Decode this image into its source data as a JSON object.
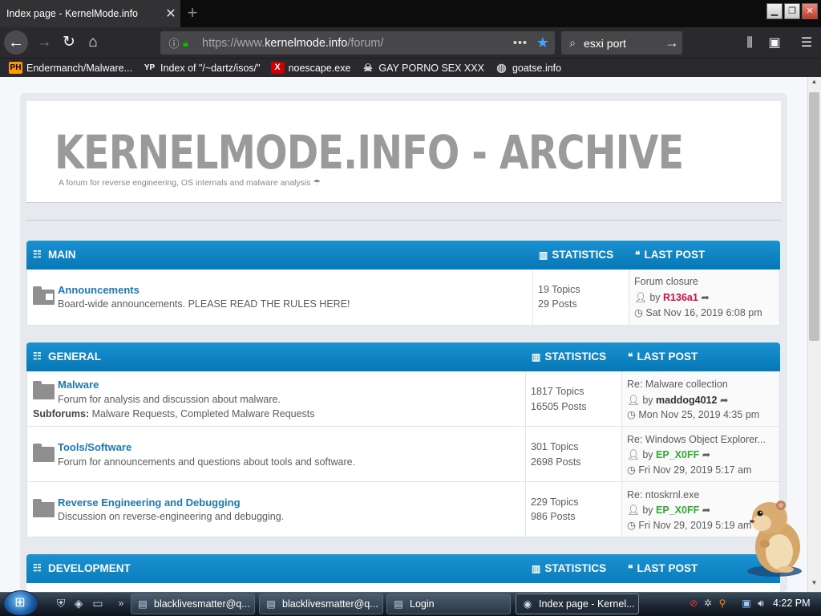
{
  "browser": {
    "tab_title": "Index page - KernelMode.info",
    "tab_close": "✕",
    "new_tab": "+",
    "url_host_pre": "https://www.",
    "url_host": "kernelmode.info",
    "url_path": "/forum/",
    "search_value": "esxi port",
    "bookmarks": [
      {
        "icon": "PH",
        "label": "Endermanch/Malware..."
      },
      {
        "icon": "YP",
        "label": "Index of \"/~dartz/isos/\""
      },
      {
        "icon": "X",
        "label": "noescape.exe"
      },
      {
        "icon": "☠",
        "label": "GAY PORNO SEX XXX"
      },
      {
        "icon": "◍",
        "label": "goatse.info"
      }
    ],
    "window_controls": [
      "▁",
      "❐",
      "✕"
    ]
  },
  "site": {
    "logo": "KERNELMODE.INFO - ARCHIVE",
    "tagline": "A forum for reverse engineering, OS internals and malware analysis ☂"
  },
  "categories": [
    {
      "title": "MAIN",
      "stats_label": "STATISTICS",
      "lastpost_label": "LAST POST",
      "forums": [
        {
          "title": "Announcements",
          "desc": "Board-wide announcements. PLEASE READ THE RULES HERE!",
          "subforums": "",
          "topics": "19 Topics",
          "posts": "29 Posts",
          "last_title": "Forum closure",
          "last_by": "by",
          "last_user": "R136a1",
          "last_user_color": "#d31141",
          "last_date": "Sat Nov 16, 2019 6:08 pm"
        }
      ]
    },
    {
      "title": "GENERAL",
      "stats_label": "STATISTICS",
      "lastpost_label": "LAST POST",
      "forums": [
        {
          "title": "Malware",
          "desc": "Forum for analysis and discussion about malware.",
          "subforums_label": "Subforums:",
          "subforums": "Malware Requests, Completed Malware Requests",
          "topics": "1817 Topics",
          "posts": "16505 Posts",
          "last_title": "Re: Malware collection",
          "last_by": "by",
          "last_user": "maddog4012",
          "last_user_color": "#333333",
          "last_date": "Mon Nov 25, 2019 4:35 pm"
        },
        {
          "title": "Tools/Software",
          "desc": "Forum for announcements and questions about tools and software.",
          "subforums": "",
          "topics": "301 Topics",
          "posts": "2698 Posts",
          "last_title": "Re: Windows Object Explorer...",
          "last_by": "by",
          "last_user": "EP_X0FF",
          "last_user_color": "#33aa33",
          "last_date": "Fri Nov 29, 2019 5:17 am"
        },
        {
          "title": "Reverse Engineering and Debugging",
          "desc": "Discussion on reverse-engineering and debugging.",
          "subforums": "",
          "topics": "229 Topics",
          "posts": "986 Posts",
          "last_title": "Re: ntoskrnl.exe",
          "last_by": "by",
          "last_user": "EP_X0FF",
          "last_user_color": "#33aa33",
          "last_date": "Fri Nov 29, 2019 5:19 am"
        }
      ]
    },
    {
      "title": "DEVELOPMENT",
      "stats_label": "STATISTICS",
      "lastpost_label": "LAST POST",
      "forums": []
    }
  ],
  "taskbar": {
    "tasks": [
      {
        "label": "blacklivesmatter@q...",
        "active": false
      },
      {
        "label": "blacklivesmatter@q...",
        "active": false
      },
      {
        "label": "Login",
        "active": false
      },
      {
        "label": "Index page - Kernel...",
        "active": true
      }
    ],
    "clock": "4:22 PM",
    "overflow": "»"
  },
  "colors": {
    "accent": "#0678b6",
    "link": "#1e77b7",
    "toolbar": "#2a2a2e",
    "page_bg": "#f5f7fa"
  }
}
